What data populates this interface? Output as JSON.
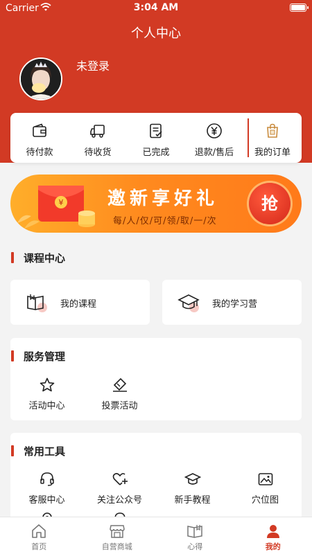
{
  "status_bar": {
    "carrier": "Carrier",
    "time": "3:04 AM"
  },
  "header": {
    "title": "个人中心",
    "username": "未登录"
  },
  "orders": [
    {
      "label": "待付款",
      "icon": "wallet-icon"
    },
    {
      "label": "待收货",
      "icon": "truck-icon"
    },
    {
      "label": "已完成",
      "icon": "checklist-icon"
    },
    {
      "label": "退款/售后",
      "icon": "yuan-circle-icon"
    },
    {
      "label": "我的订单",
      "icon": "shopping-bag-icon"
    }
  ],
  "banner": {
    "title": "邀新享好礼",
    "subtitle": "每/人/仅/可/领/取/一/次",
    "button": "抢"
  },
  "course_center": {
    "title": "课程中心",
    "items": [
      {
        "label": "我的课程",
        "icon": "open-book-icon"
      },
      {
        "label": "我的学习营",
        "icon": "graduation-cap-icon"
      }
    ]
  },
  "service": {
    "title": "服务管理",
    "items": [
      {
        "label": "活动中心",
        "icon": "star-icon"
      },
      {
        "label": "投票活动",
        "icon": "ticket-icon"
      }
    ]
  },
  "tools": {
    "title": "常用工具",
    "items": [
      {
        "label": "客服中心",
        "icon": "headset-icon"
      },
      {
        "label": "关注公众号",
        "icon": "heart-plus-icon"
      },
      {
        "label": "新手教程",
        "icon": "mortarboard-icon"
      },
      {
        "label": "穴位图",
        "icon": "image-icon"
      }
    ]
  },
  "tabbar": [
    {
      "label": "首页",
      "icon": "home-icon"
    },
    {
      "label": "自营商城",
      "icon": "store-icon"
    },
    {
      "label": "心得",
      "icon": "book-icon"
    },
    {
      "label": "我的",
      "icon": "user-icon"
    }
  ],
  "colors": {
    "brand": "#d23a24",
    "banner": "#ff8a1e"
  }
}
